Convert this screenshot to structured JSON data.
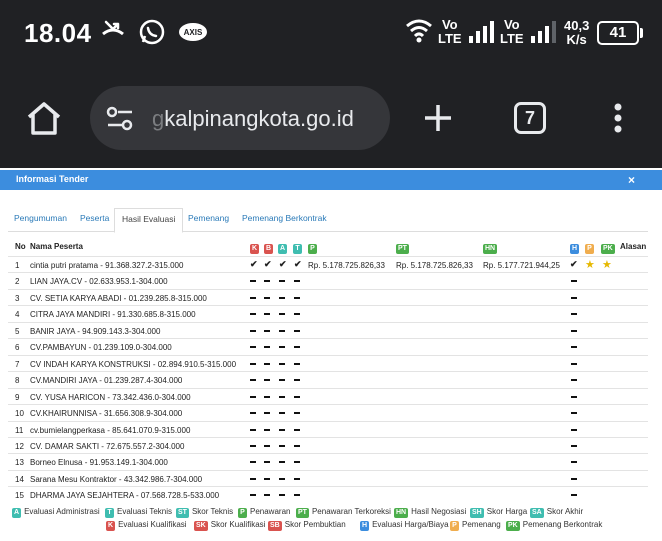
{
  "status": {
    "time": "18.04",
    "carrier1": "Vo\nLTE",
    "carrier2": "Vo\nLTE",
    "speed_value": "40,3",
    "speed_unit": "K/s",
    "battery": "41"
  },
  "browser": {
    "url_faded": "g",
    "url": "kalpinangkota.go.id",
    "tab_count": "7"
  },
  "modal": {
    "title": "Informasi Tender",
    "close": "×"
  },
  "tabs": [
    "Pengumuman",
    "Peserta",
    "Hasil Evaluasi",
    "Pemenang",
    "Pemenang Berkontrak"
  ],
  "table": {
    "headers": {
      "no": "No",
      "name": "Nama Peserta",
      "k": "K",
      "b": "B",
      "a": "A",
      "t": "T",
      "p": "P",
      "pt": "PT",
      "hn": "HN",
      "h": "H",
      "p2": "P",
      "pk": "PK",
      "alasan": "Alasan"
    },
    "rows": [
      {
        "no": "1",
        "name": "cintia putri pratama - 91.368.327.2-315.000",
        "p": "Rp. 5.178.725.826,33",
        "pt": "Rp. 5.178.725.826,33",
        "hn": "Rp. 5.177.721.944,25"
      },
      {
        "no": "2",
        "name": "LIAN JAYA.CV - 02.633.953.1-304.000"
      },
      {
        "no": "3",
        "name": "CV. SETIA KARYA ABADI - 01.239.285.8-315.000"
      },
      {
        "no": "4",
        "name": "CITRA JAYA MANDIRI - 91.330.685.8-315.000"
      },
      {
        "no": "5",
        "name": "BANIR JAYA - 94.909.143.3-304.000"
      },
      {
        "no": "6",
        "name": "CV.PAMBAYUN - 01.239.109.0-304.000"
      },
      {
        "no": "7",
        "name": "CV INDAH KARYA KONSTRUKSI - 02.894.910.5-315.000"
      },
      {
        "no": "8",
        "name": "CV.MANDIRI JAYA - 01.239.287.4-304.000"
      },
      {
        "no": "9",
        "name": "CV. YUSA HARICON - 73.342.436.0-304.000"
      },
      {
        "no": "10",
        "name": "CV.KHAIRUNNISA - 31.656.308.9-304.000"
      },
      {
        "no": "11",
        "name": "cv.bumielangperkasa - 85.641.070.9-315.000"
      },
      {
        "no": "12",
        "name": "CV. DAMAR SAKTI - 72.675.557.2-304.000"
      },
      {
        "no": "13",
        "name": "Borneo Elnusa - 91.953.149.1-304.000"
      },
      {
        "no": "14",
        "name": "Sarana Mesu Kontraktor - 43.342.986.7-304.000"
      },
      {
        "no": "15",
        "name": "DHARMA JAYA SEJAHTERA - 07.568.728.5-533.000"
      }
    ]
  },
  "legend": {
    "a_badge": "A",
    "a_label": "Evaluasi Administrasi",
    "t_badge": "T",
    "t_label": "Evaluasi Teknis",
    "st_badge": "ST",
    "st_label": "Skor Teknis",
    "p_badge": "P",
    "p_label": "Penawaran",
    "pt_badge": "PT",
    "pt_label": "Penawaran Terkoreksi",
    "hn_badge": "HN",
    "hn_label": "Hasil Negosiasi",
    "sh_badge": "SH",
    "sh_label": "Skor Harga",
    "sa_badge": "SA",
    "sa_label": "Skor Akhir",
    "k_badge": "K",
    "k_label": "Evaluasi Kualifikasi",
    "sk_badge": "SK",
    "sk_label": "Skor Kualifikasi",
    "sb_badge": "SB",
    "sb_label": "Skor Pembuktian",
    "h_badge": "H",
    "h_label": "Evaluasi Harga/Biaya",
    "pm_badge": "P",
    "pm_label": "Pemenang",
    "pk_badge": "PK",
    "pk_label": "Pemenang Berkontrak"
  },
  "colors": {
    "status_bg": "#202124",
    "modal_header": "#3c8dde",
    "badge_red": "#d9534f",
    "badge_green": "#4cae4c",
    "badge_blue": "#3c8dde",
    "badge_orange": "#f0ad4e",
    "star": "#e6b800"
  }
}
